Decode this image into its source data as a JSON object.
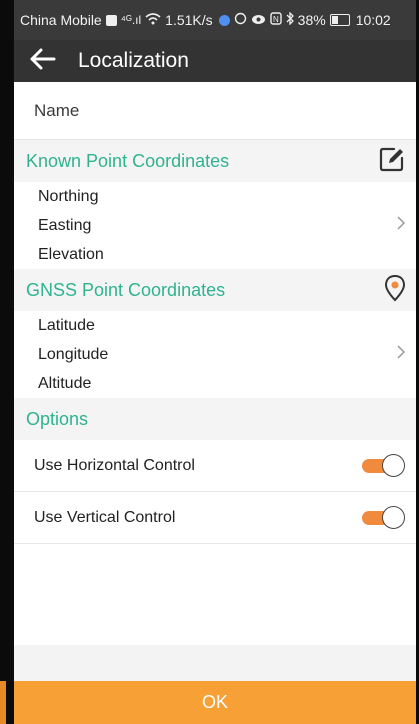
{
  "status_bar": {
    "carrier": "China Mobile",
    "signal": "⁴ᴳ.ıl",
    "speed": "1.51K/s",
    "battery": "38%",
    "time": "10:02"
  },
  "app_bar": {
    "title": "Localization"
  },
  "name_row": {
    "label": "Name"
  },
  "known_section": {
    "title": "Known Point Coordinates",
    "lines": [
      "Northing",
      "Easting",
      "Elevation"
    ]
  },
  "gnss_section": {
    "title": "GNSS Point Coordinates",
    "lines": [
      "Latitude",
      "Longitude",
      "Altitude"
    ]
  },
  "options": {
    "title": "Options",
    "items": [
      {
        "label": "Use Horizontal Control",
        "on": true
      },
      {
        "label": "Use Vertical Control",
        "on": true
      }
    ]
  },
  "ok_button": {
    "label": "OK"
  },
  "colors": {
    "accent_green": "#2fb38f",
    "toggle_orange": "#f08a3c",
    "ok_orange": "#f6a035",
    "appbar": "#333333"
  },
  "icons": [
    "back-arrow-icon",
    "edit-icon",
    "location-pin-icon",
    "chevron-right-icon"
  ]
}
